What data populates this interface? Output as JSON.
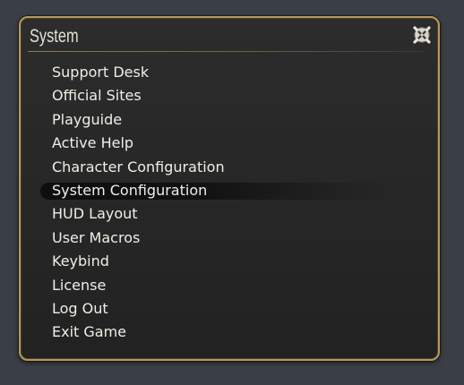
{
  "window": {
    "title": "System",
    "close_icon": "close-icon"
  },
  "menu": {
    "items": [
      {
        "label": "Support Desk"
      },
      {
        "label": "Official Sites"
      },
      {
        "label": "Playguide"
      },
      {
        "label": "Active Help"
      },
      {
        "label": "Character Configuration"
      },
      {
        "label": "System Configuration",
        "selected": true
      },
      {
        "label": "HUD Layout"
      },
      {
        "label": "User Macros"
      },
      {
        "label": "Keybind"
      },
      {
        "label": "License"
      },
      {
        "label": "Log Out"
      },
      {
        "label": "Exit Game"
      }
    ]
  },
  "colors": {
    "background": "#3a3e46",
    "panel": "#262626",
    "border_gold": "#b59a5a",
    "text": "#f1eee6"
  }
}
